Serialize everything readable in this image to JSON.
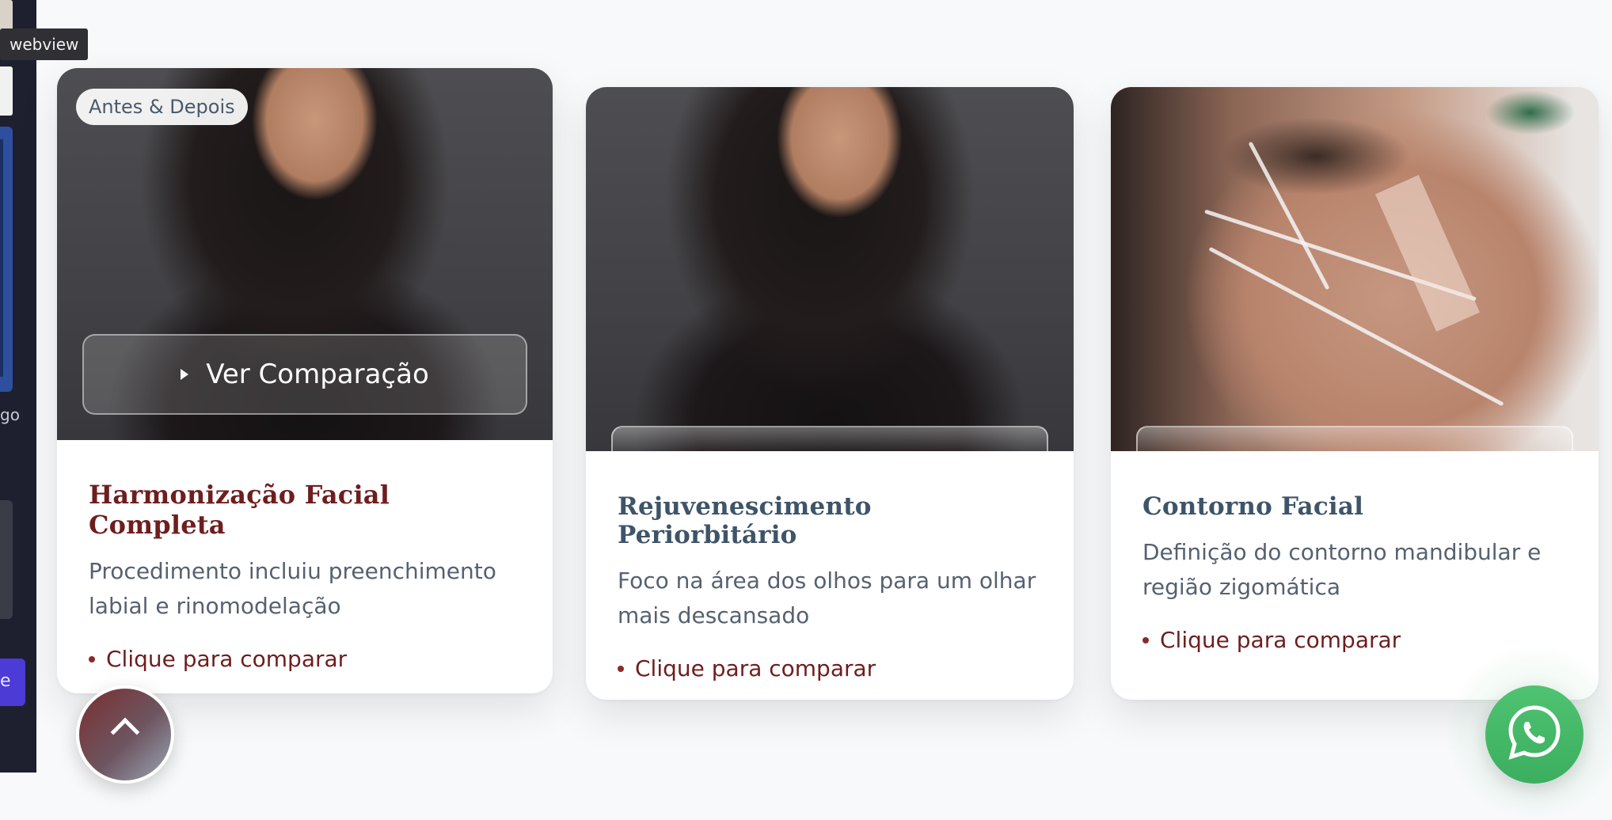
{
  "tooltip": {
    "text": "webview"
  },
  "sidebar": {
    "partial_text": "go",
    "partial_button_text": "e"
  },
  "cards": [
    {
      "badge": "Antes & Depois",
      "compare_button": "Ver Comparação",
      "title": "Harmonização Facial Completa",
      "description": "Procedimento incluiu preenchimento labial e rinomodelação",
      "cta": "Clique para comparar"
    },
    {
      "title": "Rejuvenescimento Periorbitário",
      "description": "Foco na área dos olhos para um olhar mais descansado",
      "cta": "Clique para comparar"
    },
    {
      "title": "Contorno Facial",
      "description": "Definição do contorno mandibular e região zigomática",
      "cta": "Clique para comparar"
    }
  ],
  "icons": {
    "scroll_top": "chevron-up-icon",
    "whatsapp": "whatsapp-icon",
    "play": "play-icon"
  },
  "colors": {
    "accent_burgundy": "#6e1e1e",
    "title_slate": "#3e5468",
    "whatsapp_green": "#4fc372"
  }
}
